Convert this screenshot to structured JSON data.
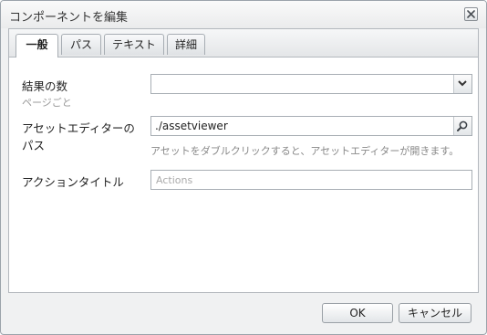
{
  "dialog": {
    "title": "コンポーネントを編集"
  },
  "tabs": [
    {
      "label": "一般",
      "active": true
    },
    {
      "label": "パス",
      "active": false
    },
    {
      "label": "テキスト",
      "active": false
    },
    {
      "label": "詳細",
      "active": false
    }
  ],
  "form": {
    "results": {
      "label": "結果の数",
      "sublabel": "ページごと",
      "value": ""
    },
    "asset_editor": {
      "label_line1": "アセットエディターの",
      "label_line2": "パス",
      "value": "./assetviewer",
      "hint": "アセットをダブルクリックすると、アセットエディターが開きます。"
    },
    "action_title": {
      "label": "アクションタイトル",
      "placeholder": "Actions"
    }
  },
  "buttons": {
    "ok": "OK",
    "cancel": "キャンセル"
  },
  "icons": {
    "close": "close-icon",
    "dropdown": "chevron-down-icon",
    "search": "search-icon"
  }
}
